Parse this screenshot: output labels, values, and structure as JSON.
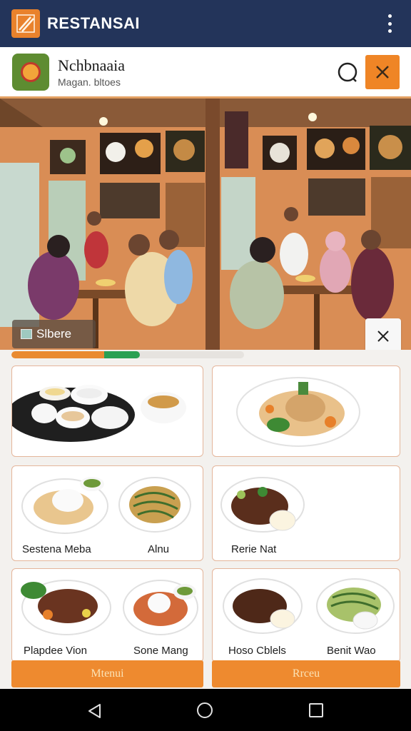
{
  "app": {
    "title": "RESTANSAI",
    "logo_icon": "pencils-logo-icon",
    "menu_icon": "more-vertical-icon"
  },
  "header": {
    "name": "Nchbnaaia",
    "subtitle": "Magan. bltoes",
    "search_icon": "search-icon",
    "close_icon": "close-icon"
  },
  "hero": {
    "label": "Slbere",
    "close_icon": "close-icon"
  },
  "progress": {
    "orange_fraction": 0.41,
    "green_fraction": 0.14
  },
  "cards": [
    {
      "labels": []
    },
    {
      "labels": []
    },
    {
      "labels": [
        "Sestena Meba",
        "Alnu"
      ]
    },
    {
      "labels": [
        "Rerie Nat"
      ]
    },
    {
      "labels": [
        "Plapdee Vion",
        "Sone Mang"
      ]
    },
    {
      "labels": [
        "Hoso Cblels",
        "Benit Wao"
      ]
    }
  ],
  "buttons": {
    "left": "Mtenui",
    "right": "Rrceu"
  },
  "colors": {
    "appbar": "#23345a",
    "accent": "#ef8526",
    "card_border": "#e4b59a",
    "progress_green": "#2aa052"
  },
  "navbar": {
    "back_icon": "back-triangle-icon",
    "home_icon": "home-circle-icon",
    "recents_icon": "recents-square-icon"
  }
}
